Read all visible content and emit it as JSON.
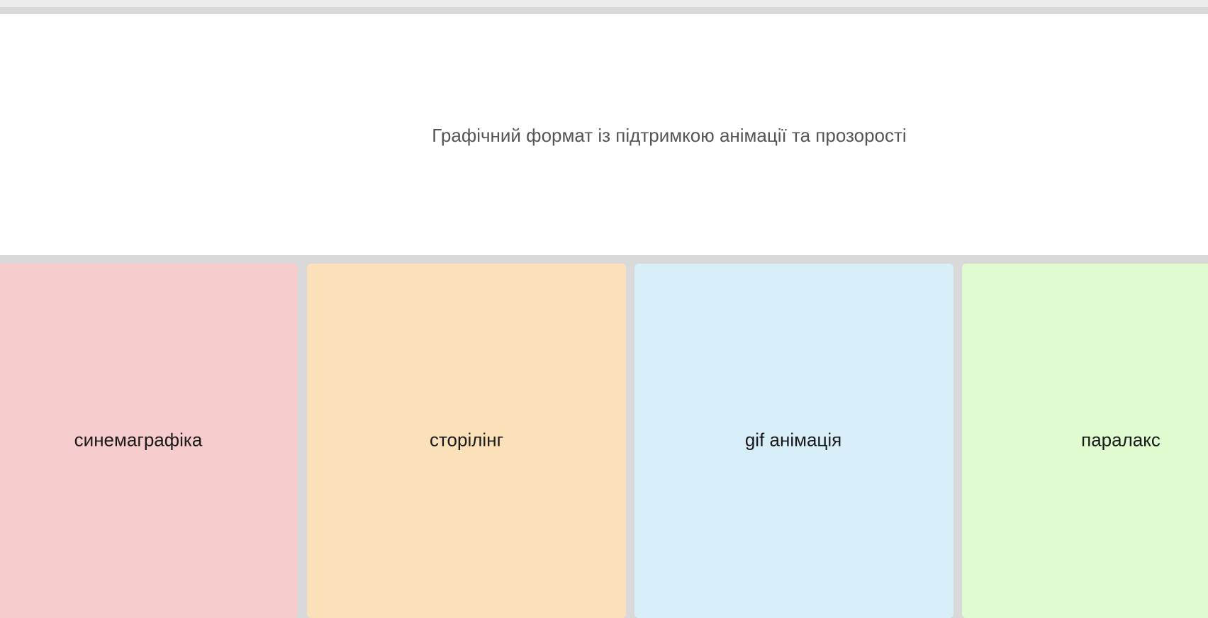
{
  "question": {
    "text": "Графічний формат із підтримкою анімації та прозорості"
  },
  "options": [
    {
      "label": "синемаграфіка",
      "color": "#f6cccd"
    },
    {
      "label": "сторілінг",
      "color": "#fbe1b9"
    },
    {
      "label": "gif анімація",
      "color": "#d8eff9"
    },
    {
      "label": "паралакс",
      "color": "#dffbcf"
    }
  ],
  "colors": {
    "background": "#d9d9d9",
    "panel": "#ffffff",
    "question_text": "#555555",
    "option_text": "#1a1a1a"
  }
}
